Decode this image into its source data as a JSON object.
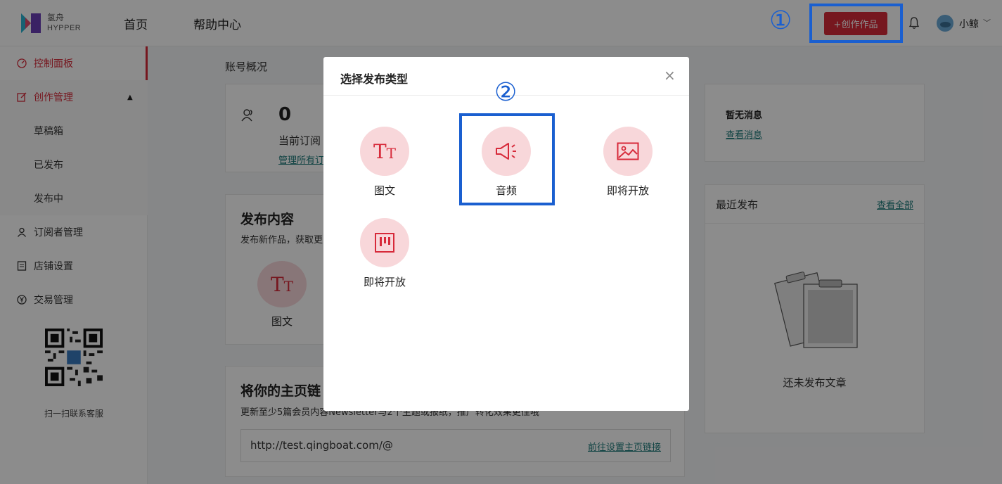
{
  "header": {
    "logo_cn": "氢舟",
    "logo_en": "HYPPER",
    "nav": [
      "首页",
      "帮助中心"
    ],
    "create_button": "+创作作品",
    "user_name": "小鲸"
  },
  "annotations": {
    "one": "①",
    "two": "②"
  },
  "sidebar": {
    "items": [
      {
        "label": "控制面板",
        "icon": "dashboard-icon"
      },
      {
        "label": "创作管理",
        "icon": "edit-icon"
      },
      {
        "label": "草稿箱"
      },
      {
        "label": "已发布"
      },
      {
        "label": "发布中"
      },
      {
        "label": "订阅者管理",
        "icon": "user-icon"
      },
      {
        "label": "店铺设置",
        "icon": "list-icon"
      },
      {
        "label": "交易管理",
        "icon": "yen-icon"
      }
    ],
    "qr_caption": "扫一扫联系客服"
  },
  "main": {
    "title": "账号概况",
    "subscribers_count": "0",
    "subscribers_label": "当前订阅",
    "manage_link": "管理所有订",
    "publish_title": "发布内容",
    "publish_desc": "发布新作品，获取更",
    "publish_option": "图文",
    "homepage_title": "将你的主页链",
    "homepage_desc": "更新至少5篇会员内容Newsletter与2个主题或报纸，推广转化效果更佳哦",
    "homepage_url": "http://test.qingboat.com/@",
    "homepage_link": "前往设置主页链接",
    "messages_title": "暂无消息",
    "messages_link": "查看消息",
    "recent_title": "最近发布",
    "recent_link": "查看全部",
    "recent_empty": "还未发布文章"
  },
  "modal": {
    "title": "选择发布类型",
    "close": "×",
    "options": [
      {
        "label": "图文",
        "icon": "text-format-icon"
      },
      {
        "label": "音频",
        "icon": "speaker-icon"
      },
      {
        "label": "即将开放",
        "icon": "image-icon"
      },
      {
        "label": "即将开放",
        "icon": "board-icon"
      }
    ]
  },
  "colors": {
    "accent": "#d72a3a",
    "annotation": "#1a5fd0",
    "link": "#1d7a7a"
  }
}
